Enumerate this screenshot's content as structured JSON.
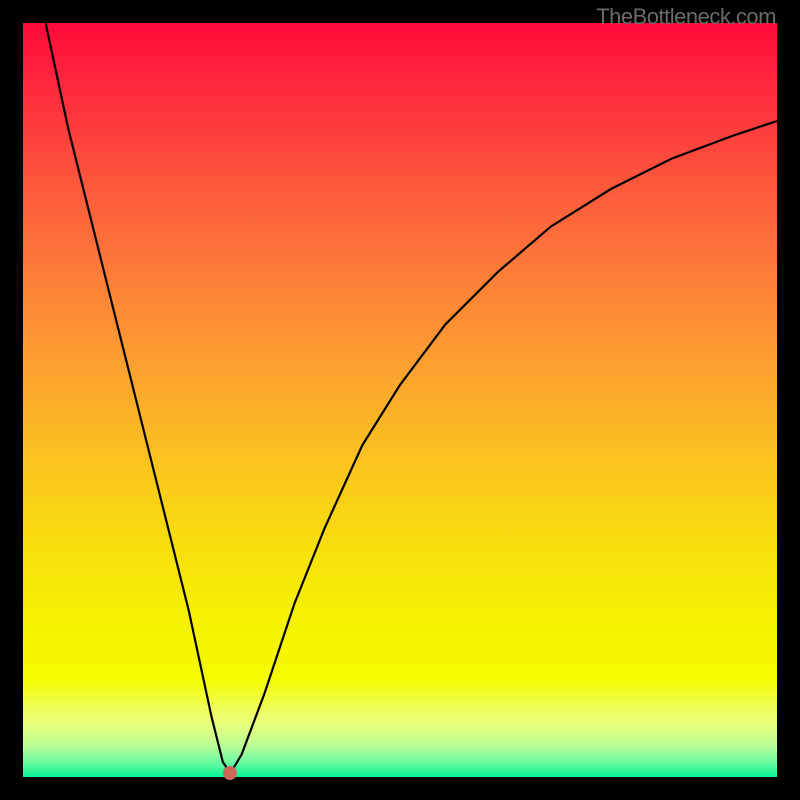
{
  "watermark": "TheBottleneck.com",
  "chart_data": {
    "type": "line",
    "title": "",
    "xlabel": "",
    "ylabel": "",
    "xlim": [
      0,
      100
    ],
    "ylim": [
      0,
      100
    ],
    "series": [
      {
        "name": "curve",
        "x": [
          3,
          6,
          10,
          14,
          18,
          22,
          25,
          26.5,
          27.5,
          29,
          32,
          36,
          40,
          45,
          50,
          56,
          63,
          70,
          78,
          86,
          94,
          100
        ],
        "values": [
          100,
          86,
          70,
          54,
          38,
          22,
          8,
          2,
          0.5,
          3,
          11,
          23,
          33,
          44,
          52,
          60,
          67,
          73,
          78,
          82,
          85,
          87
        ]
      }
    ],
    "markers": [
      {
        "name": "minimum-dot",
        "x": 27.5,
        "y": 0.5,
        "color": "#c9695a"
      }
    ],
    "background_gradient": {
      "top": "#ff0a3a",
      "bottom": "#07f497",
      "stops": [
        "red",
        "orange",
        "yellow",
        "green"
      ]
    }
  }
}
